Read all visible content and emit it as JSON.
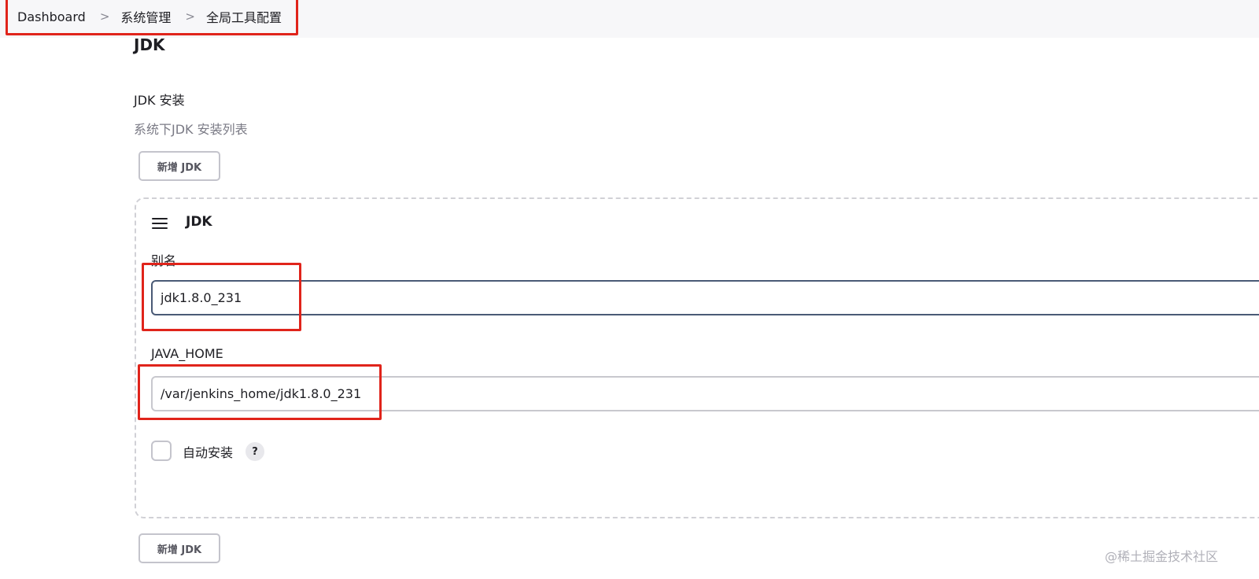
{
  "breadcrumb": {
    "items": [
      "Dashboard",
      "系统管理",
      "全局工具配置"
    ],
    "separator": ">"
  },
  "section": {
    "title": "JDK",
    "installations_label": "JDK 安装",
    "installations_desc": "系统下JDK 安装列表",
    "add_button_label": "新增 JDK"
  },
  "jdk_card": {
    "title": "JDK",
    "name_label": "别名",
    "name_value": "jdk1.8.0_231",
    "java_home_label": "JAVA_HOME",
    "java_home_value": "/var/jenkins_home/jdk1.8.0_231",
    "auto_install_label": "自动安装",
    "auto_install_checked": false,
    "help_glyph": "?"
  },
  "watermark": "@稀土掘金技术社区",
  "icons": {
    "chevron": "chevron-right-icon",
    "drag": "drag-handle-icon",
    "help": "help-icon"
  },
  "colors": {
    "highlight": "#e0241b",
    "topbar_bg": "#f7f7f9",
    "focused_border": "#4a5a76"
  }
}
